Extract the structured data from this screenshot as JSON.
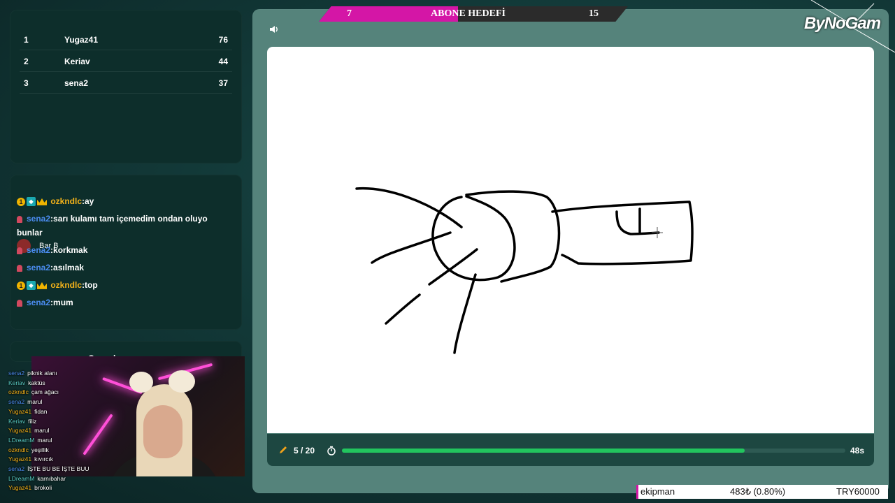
{
  "leaderboard": [
    {
      "rank": "1",
      "name": "Yugaz41",
      "score": "76"
    },
    {
      "rank": "2",
      "name": "Keriav",
      "score": "44"
    },
    {
      "rank": "3",
      "name": "sena2",
      "score": "37"
    }
  ],
  "chat": {
    "messages": [
      {
        "user": "ozkndlc",
        "text": ":ay"
      },
      {
        "user": "sena2",
        "text": ":sarı kulamı tam içemedim ondan oluyo bunlar"
      },
      {
        "user": "sena2",
        "text": ":korkmak"
      },
      {
        "user": "sena2",
        "text": ":asılmak"
      },
      {
        "user": "ozkndlc",
        "text": ":top"
      },
      {
        "user": "sena2",
        "text": ":mum"
      }
    ],
    "overlay_name": "Bar B"
  },
  "guess_panel": {
    "title": "Cevaplar"
  },
  "guess_log": [
    {
      "user": "sena2",
      "word": "piknik alanı",
      "color": "#4b8cf0"
    },
    {
      "user": "Keriav",
      "word": "kaktüs",
      "color": "#5bd0c8"
    },
    {
      "user": "ozkndlc",
      "word": "çam ağacı",
      "color": "#f3b21a"
    },
    {
      "user": "sena2",
      "word": "marul",
      "color": "#4b8cf0"
    },
    {
      "user": "Yugaz41",
      "word": "fidan",
      "color": "#f3b21a"
    },
    {
      "user": "Keriav",
      "word": "filiz",
      "color": "#5bd0c8"
    },
    {
      "user": "Yugaz41",
      "word": "marul",
      "color": "#f3b21a"
    },
    {
      "user": "LDreamM",
      "word": "marul",
      "color": "#5bd0c8"
    },
    {
      "user": "ozkndlc",
      "word": "yeşillik",
      "color": "#f3b21a"
    },
    {
      "user": "Yugaz41",
      "word": "kıvırcık",
      "color": "#f3b21a"
    },
    {
      "user": "sena2",
      "word": "İŞTE BU BE İŞTE BUU",
      "color": "#4b8cf0"
    },
    {
      "user": "LDreamM",
      "word": "karnıbahar",
      "color": "#5bd0c8"
    },
    {
      "user": "Yugaz41",
      "word": "brokoli",
      "color": "#f3b21a"
    }
  ],
  "goal": {
    "current": "7",
    "label": "ABONE HEDEFİ",
    "target": "15",
    "fraction": 0.45
  },
  "game": {
    "round": "5 / 20",
    "time_left": "48s",
    "progress": 0.8,
    "progress_color": "#22c55e"
  },
  "logo_text": "ByNoGam",
  "ticker": {
    "item": "ekipman",
    "change": "483₺ (0.80%)",
    "price": "TRY60000"
  },
  "colors": {
    "accent": "#d416a6",
    "stage_bg": "#55837b",
    "panel_bg": "#0d2e2b"
  },
  "icons": [
    "speaker-icon",
    "pencil-icon",
    "timer-icon",
    "crosshair-icon"
  ]
}
